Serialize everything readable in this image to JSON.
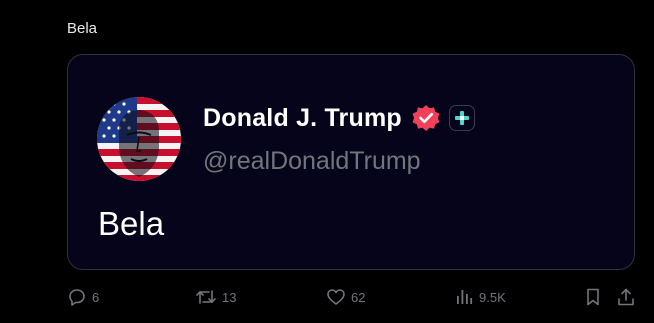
{
  "post": {
    "text": "Bela"
  },
  "card": {
    "display_name": "Donald J. Trump",
    "handle": "@realDonaldTrump",
    "text": "Bela",
    "verified_icon": "verified-badge-icon",
    "plus_icon": "plus-icon",
    "avatar_icon": "american-flag-portrait"
  },
  "actions": {
    "replies": "6",
    "reposts": "13",
    "likes": "62",
    "views": "9.5K"
  },
  "colors": {
    "background": "#000000",
    "card_background": "#05041a",
    "verified": "#f0405a",
    "plus": "#4cd7d0",
    "muted_text": "#71767b"
  }
}
